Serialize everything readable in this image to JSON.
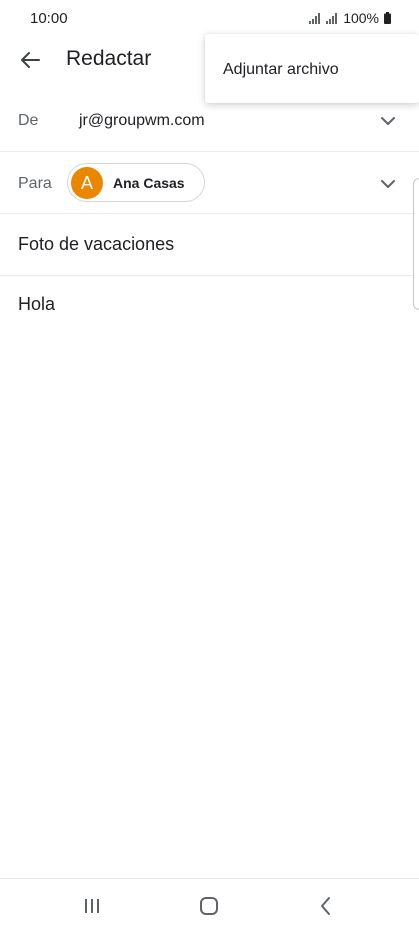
{
  "status_bar": {
    "time": "10:00",
    "battery_text": "100%",
    "icons": [
      "signal-icon",
      "signal-icon",
      "battery-icon"
    ]
  },
  "app_bar": {
    "back_icon": "arrow-back-icon",
    "title": "Redactar"
  },
  "overflow_menu": {
    "items": [
      {
        "label": "Adjuntar archivo"
      }
    ]
  },
  "compose": {
    "from": {
      "label": "De",
      "value": "jr@groupwm.com",
      "expand_icon": "chevron-down-icon"
    },
    "to": {
      "label": "Para",
      "recipients": [
        {
          "initial": "A",
          "name": "Ana Casas",
          "avatar_color": "#ea8600"
        }
      ],
      "expand_icon": "chevron-down-icon"
    },
    "subject": "Foto de vacaciones",
    "body": "Hola"
  },
  "nav_bar": {
    "icons": [
      "recent-apps-icon",
      "home-icon",
      "back-icon"
    ]
  },
  "colors": {
    "accent_avatar": "#ea8600",
    "text_primary": "#202124",
    "text_secondary": "#5f6368"
  }
}
